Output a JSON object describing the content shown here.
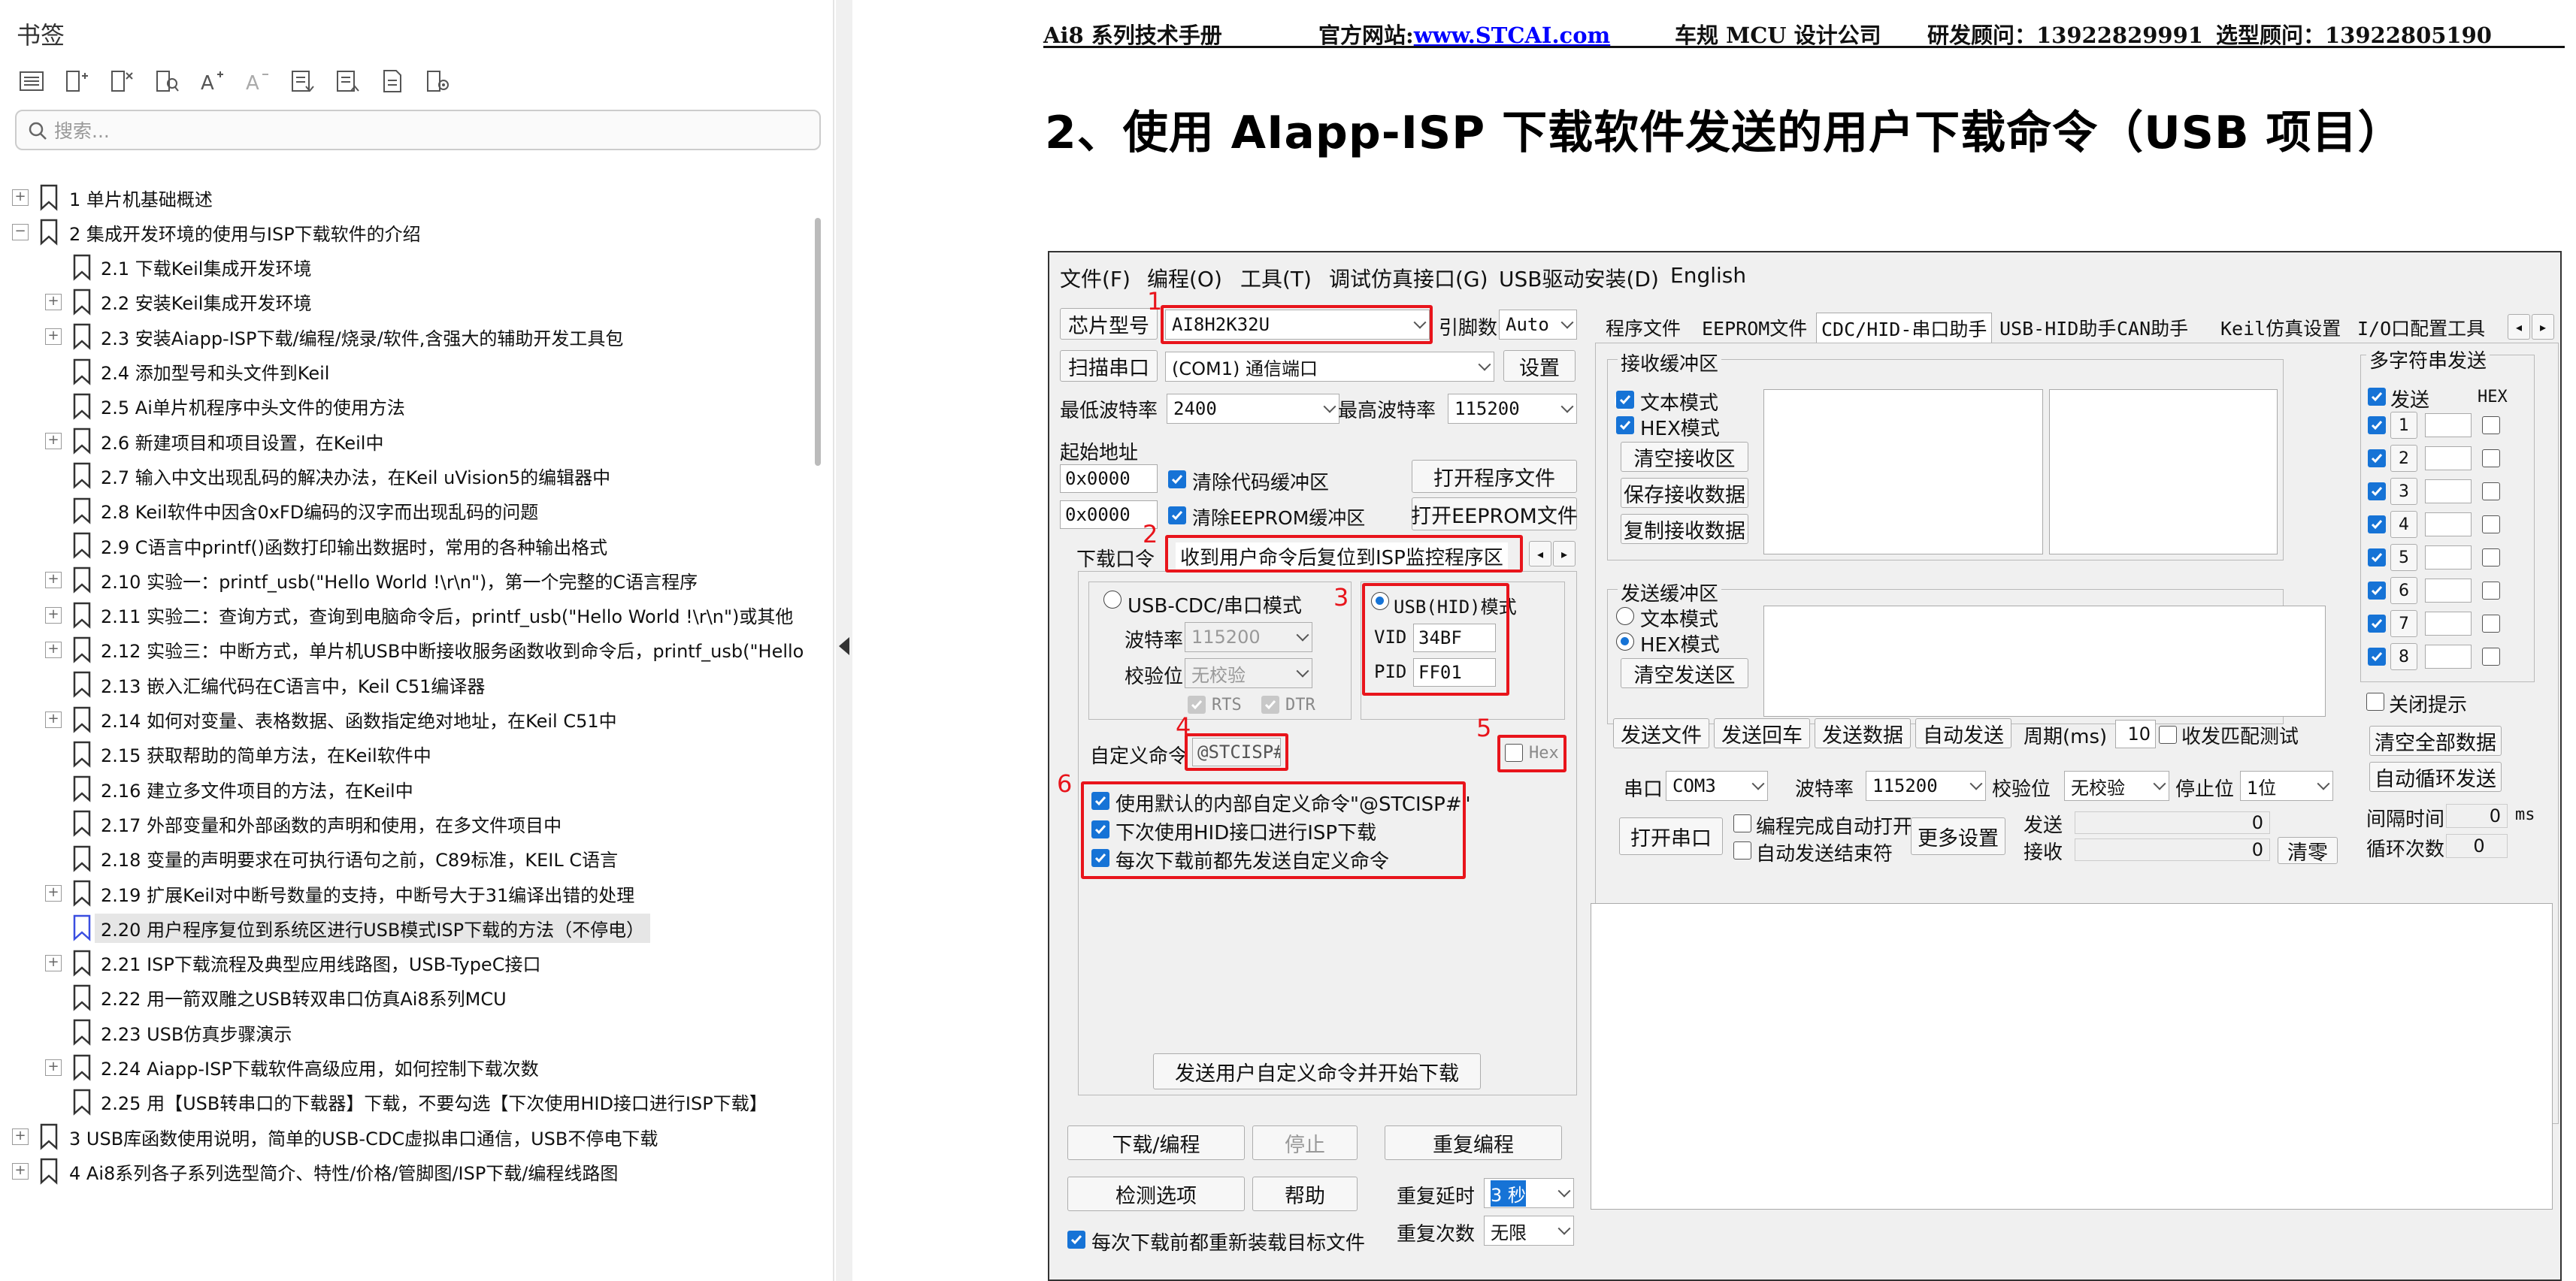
{
  "sidebar": {
    "title": "书签",
    "search_placeholder": "搜索...",
    "tree": [
      {
        "label": "1 单片机基础概述",
        "level": 0,
        "expander": "+"
      },
      {
        "label": "2  集成开发环境的使用与ISP下载软件的介绍",
        "level": 0,
        "expander": "−"
      },
      {
        "label": "2.1 下载Keil集成开发环境",
        "level": 1,
        "expander": ""
      },
      {
        "label": "2.2  安装Keil集成开发环境",
        "level": 1,
        "expander": "+"
      },
      {
        "label": "2.3  安装Aiapp-ISP下载/编程/烧录/软件,含强大的辅助开发工具包",
        "level": 1,
        "expander": "+"
      },
      {
        "label": "2.4  添加型号和头文件到Keil",
        "level": 1,
        "expander": ""
      },
      {
        "label": "2.5  Ai单片机程序中头文件的使用方法",
        "level": 1,
        "expander": ""
      },
      {
        "label": "2.6  新建项目和项目设置，在Keil中",
        "level": 1,
        "expander": "+"
      },
      {
        "label": "2.7  输入中文出现乱码的解决办法，在Keil uVision5的编辑器中",
        "level": 1,
        "expander": ""
      },
      {
        "label": "2.8  Keil软件中因含0xFD编码的汉字而出现乱码的问题",
        "level": 1,
        "expander": ""
      },
      {
        "label": "2.9  C语言中printf()函数打印输出数据时，常用的各种输出格式",
        "level": 1,
        "expander": ""
      },
      {
        "label": "2.10  实验一：printf_usb(\"Hello World !\\r\\n\")，第一个完整的C语言程序",
        "level": 1,
        "expander": "+"
      },
      {
        "label": "2.11  实验二：查询方式，查询到电脑命令后，printf_usb(\"Hello World !\\r\\n\")或其他",
        "level": 1,
        "expander": "+"
      },
      {
        "label": "2.12  实验三：中断方式，单片机USB中断接收服务函数收到命令后，printf_usb(\"Hello",
        "level": 1,
        "expander": "+"
      },
      {
        "label": "2.13  嵌入汇编代码在C语言中，Keil C51编译器",
        "level": 1,
        "expander": ""
      },
      {
        "label": "2.14  如何对变量、表格数据、函数指定绝对地址，在Keil C51中",
        "level": 1,
        "expander": "+"
      },
      {
        "label": "2.15  获取帮助的简单方法，在Keil软件中",
        "level": 1,
        "expander": ""
      },
      {
        "label": "2.16  建立多文件项目的方法，在Keil中",
        "level": 1,
        "expander": ""
      },
      {
        "label": "2.17  外部变量和外部函数的声明和使用，在多文件项目中",
        "level": 1,
        "expander": ""
      },
      {
        "label": "2.18 变量的声明要求在可执行语句之前，C89标准，KEIL C语言",
        "level": 1,
        "expander": ""
      },
      {
        "label": "2.19  扩展Keil对中断号数量的支持，中断号大于31编译出错的处理",
        "level": 1,
        "expander": "+"
      },
      {
        "label": "2.20  用户程序复位到系统区进行USB模式ISP下载的方法（不停电）",
        "level": 1,
        "expander": "",
        "selected": true
      },
      {
        "label": "2.21  ISP下载流程及典型应用线路图，USB-TypeC接口",
        "level": 1,
        "expander": "+"
      },
      {
        "label": "2.22  用一箭双雕之USB转双串口仿真Ai8系列MCU",
        "level": 1,
        "expander": ""
      },
      {
        "label": "2.23  USB仿真步骤演示",
        "level": 1,
        "expander": ""
      },
      {
        "label": "2.24  Aiapp-ISP下载软件高级应用，如何控制下载次数",
        "level": 1,
        "expander": "+"
      },
      {
        "label": "2.25  用【USB转串口的下载器】下载，不要勾选【下次使用HID接口进行ISP下载】",
        "level": 1,
        "expander": ""
      },
      {
        "label": "3 USB库函数使用说明，简单的USB-CDC虚拟串口通信，USB不停电下载",
        "level": 0,
        "expander": "+"
      },
      {
        "label": "4  Ai8系列各子系列选型简介、特性/价格/管脚图/ISP下载/编程线路图",
        "level": 0,
        "expander": "+"
      }
    ]
  },
  "document": {
    "header": {
      "manual": "Ai8 系列技术手册",
      "site_label": "官方网站:",
      "site_link": "www.STCAI.com",
      "company": "车规 MCU 设计公司",
      "advisor": "研发顾问：13922829991",
      "sales": "选型顾问：13922805190"
    },
    "heading": "2、使用 AIapp-ISP 下载软件发送的用户下载命令（USB 项目）"
  },
  "app": {
    "menu": [
      "文件(F)",
      "编程(O)",
      "工具(T)",
      "调试仿真接口(G)",
      "USB驱动安装(D)",
      "English"
    ],
    "chip_label": "芯片型号",
    "chip_value": "AI8H2K32U",
    "pins_label": "引脚数",
    "pins_value": "Auto",
    "scan_button": "扫描串口",
    "port_value": "(COM1) 通信端口",
    "settings_button": "设置",
    "min_baud_label": "最低波特率",
    "min_baud_value": "2400",
    "max_baud_label": "最高波特率",
    "max_baud_value": "115200",
    "start_addr_label": "起始地址",
    "addr1": "0x0000",
    "addr2": "0x0000",
    "clear_code_label": "清除代码缓冲区",
    "clear_eeprom_label": "清除EEPROM缓冲区",
    "open_prog_button": "打开程序文件",
    "open_eeprom_button": "打开EEPROM文件",
    "download_cmd_tab": "下载口令",
    "reset_tab": "收到用户命令后复位到ISP监控程序区",
    "usb_cdc_label": "USB-CDC/串口模式",
    "usb_hid_label": "USB(HID)模式",
    "baud_label": "波特率",
    "baud_value": "115200",
    "parity_label": "校验位",
    "parity_value": "无校验",
    "rts_label": "RTS",
    "dtr_label": "DTR",
    "vid_label": "VID",
    "vid_value": "34BF",
    "pid_label": "PID",
    "pid_value": "FF01",
    "custom_cmd_label": "自定义命令",
    "custom_cmd_value": "@STCISP#",
    "hex_label": "Hex",
    "opt1": "使用默认的内部自定义命令\"@STCISP#\"",
    "opt2": "下次使用HID接口进行ISP下载",
    "opt3": "每次下载前都先发送自定义命令",
    "send_custom_button": "发送用户自定义命令并开始下载",
    "download_button": "下载/编程",
    "stop_button": "停止",
    "reprogram_button": "重复编程",
    "check_button": "检测选项",
    "help_button": "帮助",
    "repeat_delay_label": "重复延时",
    "repeat_delay_value": "3 秒",
    "repeat_count_label": "重复次数",
    "repeat_count_value": "无限",
    "reload_label": "每次下载前都重新装载目标文件",
    "right_tabs": [
      "程序文件",
      "EEPROM文件",
      "CDC/HID-串口助手",
      "USB-HID助手",
      "CAN助手",
      "Keil仿真设置",
      "I/O口配置工具"
    ],
    "recv_group": "接收缓冲区",
    "text_mode": "文本模式",
    "hex_mode": "HEX模式",
    "clear_recv": "清空接收区",
    "save_recv": "保存接收数据",
    "copy_recv": "复制接收数据",
    "send_group": "发送缓冲区",
    "clear_send": "清空发送区",
    "send_file": "发送文件",
    "send_return": "发送回车",
    "send_data": "发送数据",
    "auto_send": "自动发送",
    "period_label": "周期(ms)",
    "period_value": "10",
    "match_test": "收发匹配测试",
    "port_label": "串口",
    "port_sel": "COM3",
    "baud2_label": "波特率",
    "baud2_value": "115200",
    "parity2_label": "校验位",
    "parity2_value": "无校验",
    "stop_label": "停止位",
    "stop_value": "1位",
    "open_port": "打开串口",
    "auto_open": "编程完成自动打开",
    "auto_end": "自动发送结束符",
    "more_settings": "更多设置",
    "send_cnt_label": "发送",
    "send_cnt": "0",
    "recv_cnt_label": "接收",
    "recv_cnt": "0",
    "clear_cnt": "清零",
    "multi_group": "多字符串发送",
    "multi_send": "发送",
    "multi_hex": "HEX",
    "multi_rows": [
      "1",
      "2",
      "3",
      "4",
      "5",
      "6",
      "7",
      "8"
    ],
    "close_tip": "关闭提示",
    "clear_all": "清空全部数据",
    "auto_loop": "自动循环发送",
    "interval_label": "间隔时间",
    "interval_value": "0",
    "interval_unit": "ms",
    "loop_label": "循环次数",
    "loop_value": "0",
    "markers": [
      "1",
      "2",
      "3",
      "4",
      "5",
      "6"
    ]
  }
}
